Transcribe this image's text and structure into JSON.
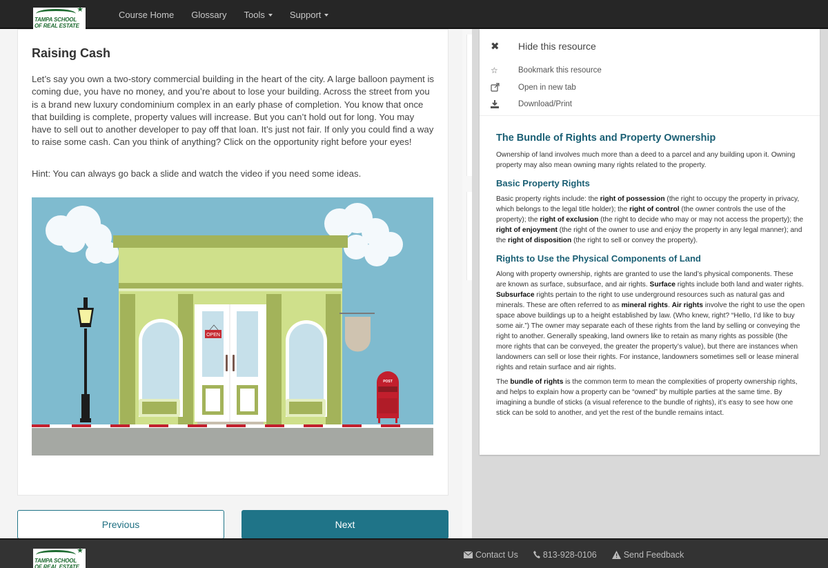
{
  "brand": {
    "logo_line1": "TAMPA SCHOOL",
    "logo_line2": "OF REAL ESTATE",
    "accent": "#1f7488",
    "heading_color": "#1a5f74"
  },
  "nav": {
    "items": [
      {
        "label": "Course Home",
        "dropdown": false
      },
      {
        "label": "Glossary",
        "dropdown": false
      },
      {
        "label": "Tools",
        "dropdown": true
      },
      {
        "label": "Support",
        "dropdown": true
      }
    ]
  },
  "lesson": {
    "title": "Raising Cash",
    "body": "Let’s say you own a two-story commercial building in the heart of the city. A large balloon payment is coming due, you have no money, and you’re about to lose your building. Across the street from you is a brand new luxury condominium complex in an early phase of completion. You know that once that building is complete, property values will increase. But you can’t hold out for long. You may have to sell out to another developer to pay off that loan. It’s just not fair. If only you could find a way to raise some cash. Can you think of anything? Click on the opportunity right before your eyes!",
    "hint": "Hint: You can always go back a slide and watch the video if you need some ideas.",
    "illustration": {
      "description": "storefront-illustration",
      "open_sign": "OPEN",
      "post_label": "POST"
    }
  },
  "navigation_buttons": {
    "previous": "Previous",
    "next": "Next"
  },
  "resource_panel": {
    "menu": [
      {
        "icon": "close-icon",
        "label": "Hide this resource"
      },
      {
        "icon": "star-icon",
        "label": "Bookmark this resource"
      },
      {
        "icon": "external-link-icon",
        "label": "Open in new tab"
      },
      {
        "icon": "download-icon",
        "label": "Download/Print"
      }
    ],
    "title": "The Bundle of Rights and Property Ownership",
    "intro": "Ownership of land involves much more than a deed to a parcel and any building upon it. Owning property may also mean owning many rights related to the property.",
    "sections": [
      {
        "heading": "Basic Property Rights",
        "segments": [
          {
            "t": "Basic property rights include: the ",
            "b": false
          },
          {
            "t": "right of possession",
            "b": true
          },
          {
            "t": " (the right to occupy the property in privacy, which belongs to the legal title holder); the ",
            "b": false
          },
          {
            "t": "right of control",
            "b": true
          },
          {
            "t": " (the owner controls the use of the property); the ",
            "b": false
          },
          {
            "t": "right of exclusion",
            "b": true
          },
          {
            "t": " (the right to decide who may or may not access the property); the ",
            "b": false
          },
          {
            "t": "right of enjoyment",
            "b": true
          },
          {
            "t": " (the right of the owner to use and enjoy the property in any legal manner); and the ",
            "b": false
          },
          {
            "t": "right of disposition",
            "b": true
          },
          {
            "t": " (the right to sell or convey the property).",
            "b": false
          }
        ]
      },
      {
        "heading": "Rights to Use the Physical Components of Land",
        "segments": [
          {
            "t": "Along with property ownership, rights are granted to use the land’s physical components. These are known as surface, subsurface, and air rights. ",
            "b": false
          },
          {
            "t": "Surface",
            "b": true
          },
          {
            "t": " rights include both land and water rights. ",
            "b": false
          },
          {
            "t": "Subsurface",
            "b": true
          },
          {
            "t": " rights pertain to the right to use underground resources such as natural gas and minerals. These are often referred to as ",
            "b": false
          },
          {
            "t": "mineral rights",
            "b": true
          },
          {
            "t": ". ",
            "b": false
          },
          {
            "t": "Air rights",
            "b": true
          },
          {
            "t": " involve the right to use the open space above buildings up to a height established by law. (Who knew, right? “Hello, I’d like to buy some air.”) The owner may separate each of these rights from the land by selling or conveying the right to another. Generally speaking, land owners like to retain as many rights as possible (the more rights that can be conveyed, the greater the property’s value), but there are instances when landowners can sell or lose their rights. For instance, landowners sometimes sell or lease mineral rights and retain surface and air rights.",
            "b": false
          }
        ]
      }
    ],
    "closing_segments": [
      {
        "t": "The ",
        "b": false
      },
      {
        "t": "bundle of rights",
        "b": true
      },
      {
        "t": " is the common term to mean the complexities of property ownership rights, and helps to explain how a property can be “owned” by multiple parties at the same time. By imagining a bundle of sticks (a visual reference to the bundle of rights), it’s easy to see how one stick can be sold to another, and yet the rest of the bundle remains intact.",
        "b": false
      }
    ]
  },
  "footer": {
    "links": [
      {
        "icon": "envelope-icon",
        "label": "Contact Us"
      },
      {
        "icon": "phone-icon",
        "label": "813-928-0106"
      },
      {
        "icon": "warning-icon",
        "label": "Send Feedback"
      }
    ]
  }
}
